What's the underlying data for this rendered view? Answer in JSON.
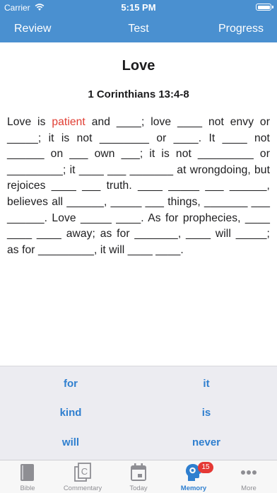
{
  "status_bar": {
    "carrier": "Carrier",
    "time": "5:15 PM"
  },
  "nav": {
    "review": "Review",
    "test": "Test",
    "progress": "Progress"
  },
  "title": "Love",
  "reference": "1 Corinthians 13:4-8",
  "passage": {
    "before": "Love is ",
    "highlight": "patient",
    "after": " and ____; love ____ not envy or _____; it is not ________ or ____. It ____ not ______ on ___ own ___; it is not _________ or _________; it ____ ___ _______ at wrongdoing, but rejoices ____ ___ truth. ____ _____ ___ ______, believes all ______, _____ ___ things, _______ ___ ______. Love _____ ____. As for prophecies, ____ ____ ____ away; as for _______, ____ will _____; as for _________, it will ____ ____."
  },
  "word_bank": {
    "w1": "for",
    "w2": "it",
    "w3": "kind",
    "w4": "is",
    "w5": "will",
    "w6": "never"
  },
  "tabs": {
    "bible": "Bible",
    "commentary": "Commentary",
    "today": "Today",
    "memory": "Memory",
    "more": "More",
    "memory_badge": "15"
  },
  "colors": {
    "accent": "#4a90d0",
    "link": "#2f7fcf",
    "highlight": "#e03c31",
    "badge": "#e53935"
  }
}
